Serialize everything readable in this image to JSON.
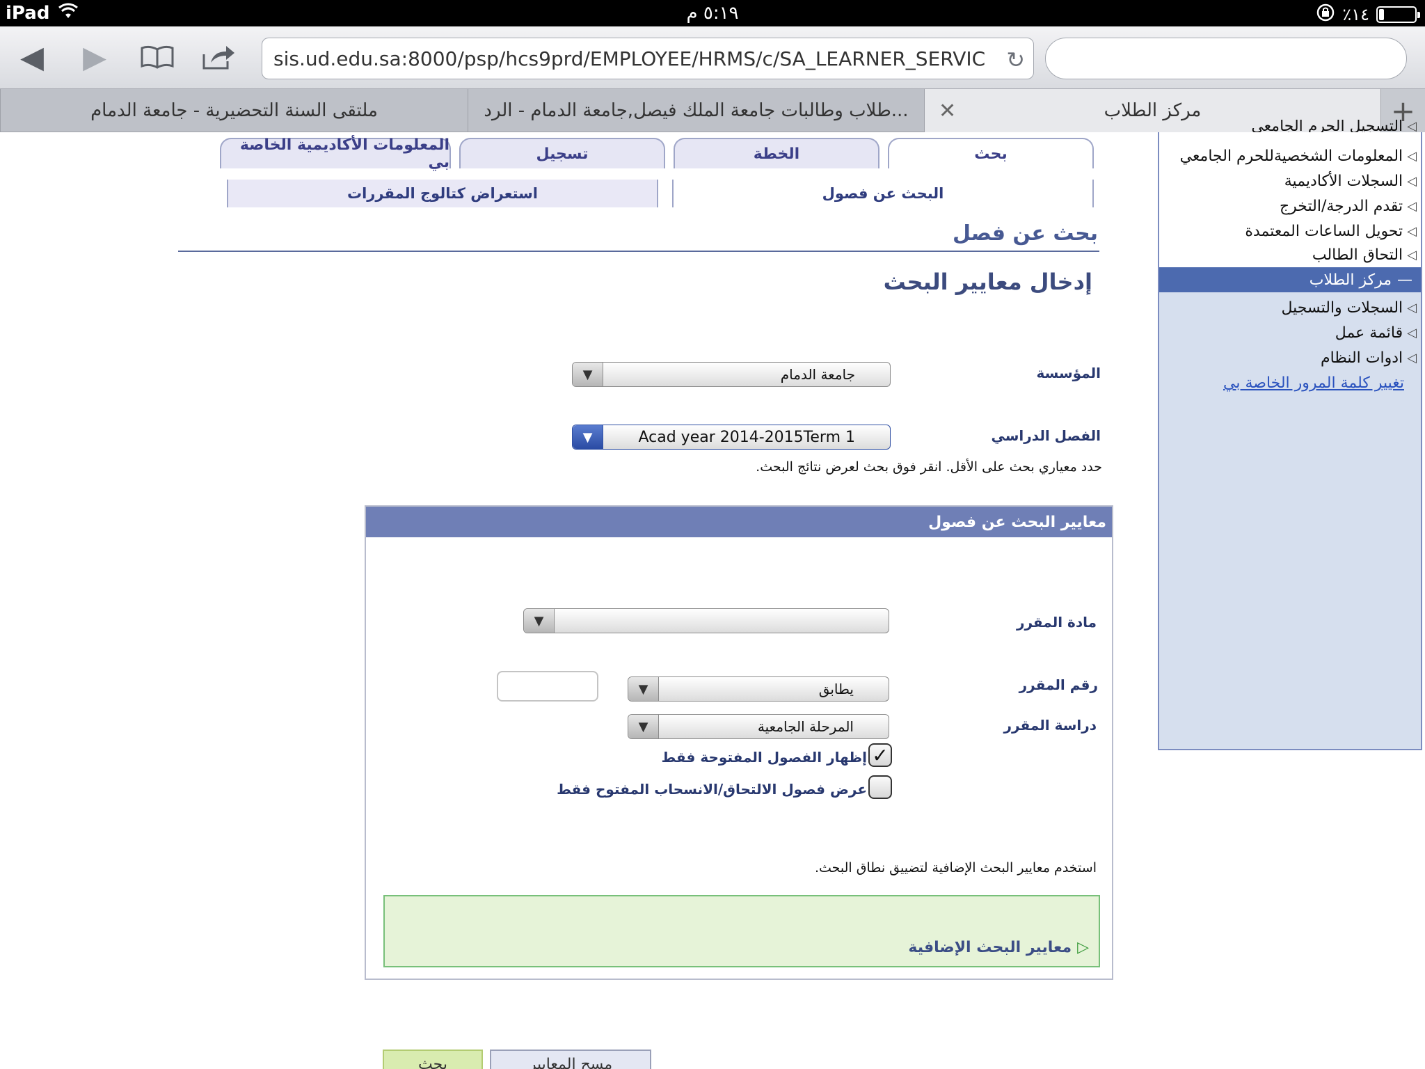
{
  "status_bar": {
    "device": "iPad",
    "time": "٥:١٩ م",
    "battery": "٪١٤",
    "battery_level": 0.14
  },
  "browser": {
    "url": "sis.ud.edu.sa:8000/psp/hcs9prd/EMPLOYEE/HRMS/c/SA_LEARNER_SERVIC",
    "search_placeholder": "",
    "tabs": [
      {
        "label": "مركز الطلاب",
        "active": true
      },
      {
        "label": "طلاب وطالبات جامعة الملك فيصل,جامعة الدمام - الرد...",
        "active": false
      },
      {
        "label": "ملتقى السنة التحضيرية - جامعة الدمام",
        "active": false
      }
    ]
  },
  "nav": {
    "partial_top": "التسجيل الحرم الجامعي",
    "items_top": [
      "المعلومات الشخصيةللحرم الجامعي",
      "السجلات الأكاديمية",
      "تقدم الدرجة/التخرج",
      "تحويل الساعات المعتمدة",
      "التحاق الطالب"
    ],
    "active": "مركز الطلاب",
    "items_bottom": [
      "السجلات والتسجيل",
      "قائمة عمل",
      "ادوات النظام"
    ],
    "link": "تغيير كلمة المرور الخاصة بي"
  },
  "app_tabs": [
    "بحث",
    "الخطة",
    "تسجيل",
    "المعلومات الأكاديمية الخاصة بي"
  ],
  "sub_tabs": [
    "البحث عن فصول",
    "استعراض كتالوج المقررات"
  ],
  "page_title": "بحث عن فصل",
  "section_title": "إدخال معايير البحث",
  "form": {
    "institution_label": "المؤسسة",
    "institution_value": "جامعة الدمام",
    "term_label": "الفصل الدراسي",
    "term_value": "Acad year 2014-2015Term 1",
    "hint": "حدد معياري بحث على الأقل. انقر فوق بحث لعرض نتائج البحث."
  },
  "criteria": {
    "header": "معايير البحث عن فصول",
    "subject_label": "مادة المقرر",
    "subject_value": "",
    "course_number_label": "رقم المقرر",
    "course_number_op": "يطابق",
    "course_number_value": "",
    "career_label": "دراسة المقرر",
    "career_value": "المرحلة الجامعية",
    "open_only_label": "إظهار الفصول المفتوحة فقط",
    "open_only_checked": true,
    "open_enrollment_label": "عرض فصول الالتحاق/الانسحاب المفتوح فقط",
    "open_enrollment_checked": false,
    "additional_hint": "استخدم معايير البحث الإضافية لتضييق نطاق البحث.",
    "additional_link": "معايير البحث الإضافية"
  },
  "buttons": {
    "search": "بحث",
    "clear": "مسح المعايير"
  }
}
